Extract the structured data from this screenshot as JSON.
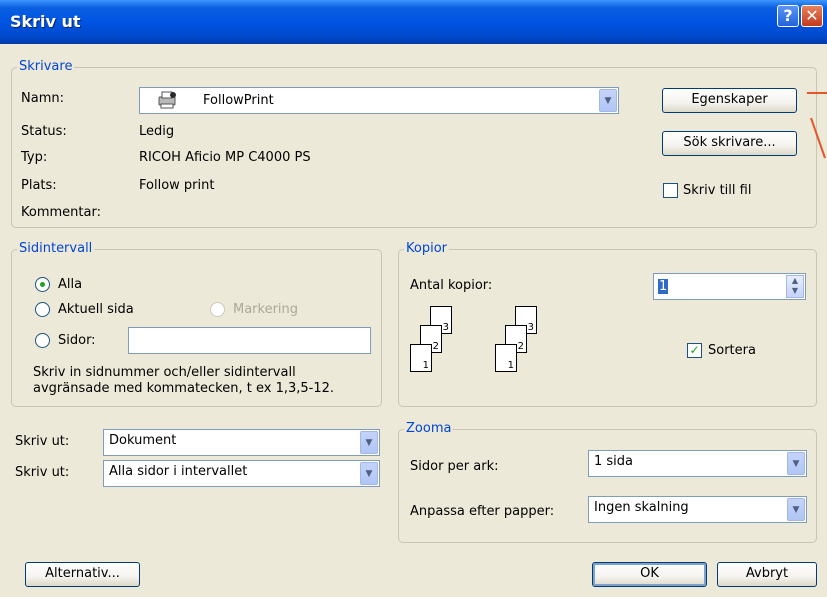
{
  "window": {
    "title": "Skriv ut"
  },
  "printer": {
    "legend": "Skrivare",
    "name_label": "Namn:",
    "name_value": "FollowPrint",
    "status_label": "Status:",
    "status_value": "Ledig",
    "type_label": "Typ:",
    "type_value": "RICOH Aficio MP C4000 PS",
    "location_label": "Plats:",
    "location_value": "Follow print",
    "comment_label": "Kommentar:",
    "comment_value": "",
    "properties_button": "Egenskaper",
    "find_printer_button": "Sök skrivare...",
    "print_to_file_label": "Skriv till fil",
    "print_to_file_checked": false
  },
  "page_range": {
    "legend": "Sidintervall",
    "all_label": "Alla",
    "current_label": "Aktuell sida",
    "selection_label": "Markering",
    "pages_label": "Sidor:",
    "pages_value": "",
    "hint_line1": "Skriv in sidnummer och/eller sidintervall",
    "hint_line2": "avgränsade med kommatecken, t ex 1,3,5-12.",
    "selected": "all"
  },
  "copies": {
    "legend": "Kopior",
    "count_label": "Antal kopior:",
    "count_value": "1",
    "collate_label": "Sortera",
    "collate_checked": true,
    "stack_pages": [
      "3",
      "2",
      "1"
    ]
  },
  "print_what": {
    "label": "Skriv ut:",
    "value": "Dokument"
  },
  "print_range": {
    "label": "Skriv ut:",
    "value": "Alla sidor i intervallet"
  },
  "zoom": {
    "legend": "Zooma",
    "pages_per_sheet_label": "Sidor per ark:",
    "pages_per_sheet_value": "1 sida",
    "scale_label": "Anpassa efter papper:",
    "scale_value": "Ingen skalning"
  },
  "buttons": {
    "options": "Alternativ...",
    "ok": "OK",
    "cancel": "Avbryt"
  },
  "colors": {
    "titlebar": "#0054e3",
    "dialog_bg": "#ece9d8",
    "group_legend": "#0046d5",
    "annotation": "#e2562b"
  }
}
